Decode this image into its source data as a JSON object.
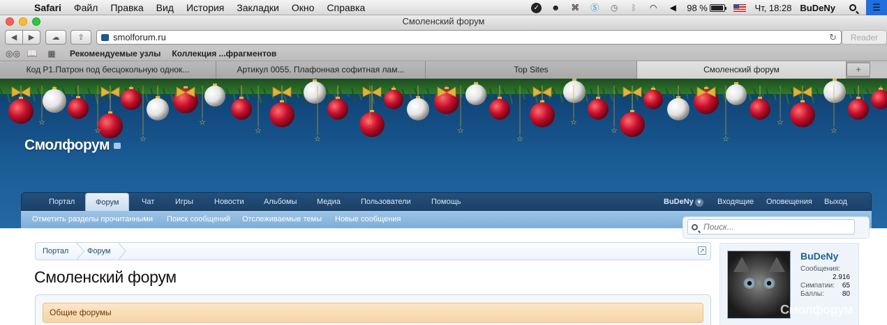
{
  "menubar": {
    "app": "Safari",
    "items": [
      "Файл",
      "Правка",
      "Вид",
      "История",
      "Закладки",
      "Окно",
      "Справка"
    ],
    "battery": "98 %",
    "clock": "Чт, 18:28",
    "user": "BuDeNy"
  },
  "window": {
    "title": "Смоленский форум"
  },
  "toolbar": {
    "url": "smolforum.ru",
    "reader": "Reader"
  },
  "bookmarks": {
    "items": [
      "Рекомендуемые узлы",
      "Коллекция ...фрагментов"
    ]
  },
  "tabs": [
    {
      "label": "Код P1.Патрон под бесцокольную однок..."
    },
    {
      "label": "Артикул 0055. Плафонная софитная лам..."
    },
    {
      "label": "Top Sites"
    },
    {
      "label": "Смоленский форум",
      "active": true
    }
  ],
  "site": {
    "logo": "Смолфорум",
    "nav": {
      "tabs": [
        "Портал",
        "Форум",
        "Чат",
        "Игры",
        "Новости",
        "Альбомы",
        "Медиа",
        "Пользователи",
        "Помощь"
      ],
      "active": "Форум",
      "user": "BuDeNy",
      "right": [
        "Входящие",
        "Оповещения",
        "Выход"
      ]
    },
    "subnav": [
      "Отметить разделы прочитанными",
      "Поиск сообщений",
      "Отслеживаемые темы",
      "Новые сообщения"
    ],
    "search": {
      "placeholder": "Поиск..."
    },
    "breadcrumb": [
      "Портал",
      "Форум"
    ],
    "page_title": "Смоленский форум",
    "forum_category": "Общие форумы",
    "watermark": "Смолфорум",
    "sidebar": {
      "username": "BuDeNy",
      "stats": [
        {
          "label": "Сообщения:",
          "value": "2.916"
        },
        {
          "label": "Симпатии:",
          "value": "65"
        },
        {
          "label": "Баллы:",
          "value": "80"
        }
      ]
    }
  },
  "colors": {
    "header_blue": "#1a5b94",
    "nav_dark": "#1b4168",
    "subnav_light": "#7fadd7",
    "category_orange": "#f6d4a7"
  }
}
